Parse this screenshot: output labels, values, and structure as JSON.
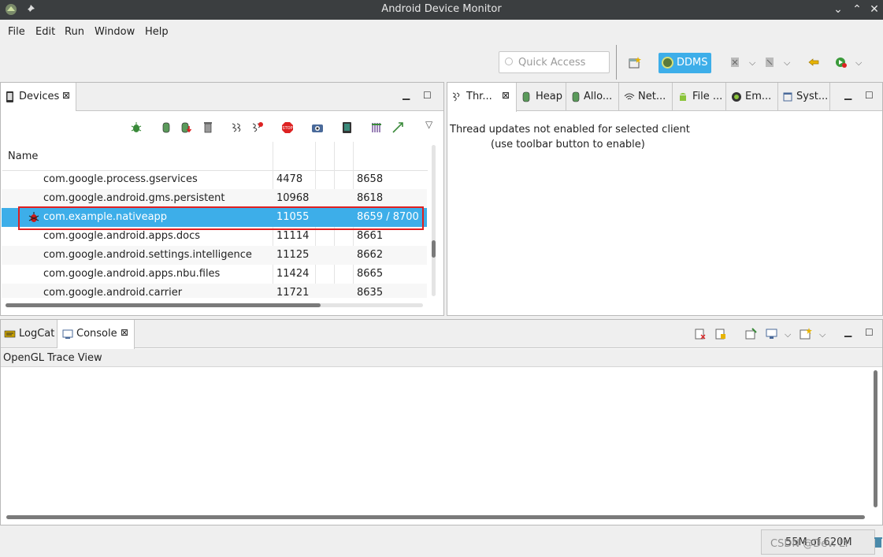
{
  "window": {
    "title": "Android Device Monitor"
  },
  "menu": [
    "File",
    "Edit",
    "Run",
    "Window",
    "Help"
  ],
  "toolbar": {
    "quick_access_placeholder": "Quick Access",
    "perspective_label": "DDMS"
  },
  "devices_panel": {
    "tab_label": "Devices",
    "column_header": "Name",
    "rows": [
      {
        "name": "com.google.process.gservices",
        "pid": "4478",
        "port": "8658"
      },
      {
        "name": "com.google.android.gms.persistent",
        "pid": "10968",
        "port": "8618"
      },
      {
        "name": "com.example.nativeapp",
        "pid": "11055",
        "port": "8659 / 8700"
      },
      {
        "name": "com.google.android.apps.docs",
        "pid": "11114",
        "port": "8661"
      },
      {
        "name": "com.google.android.settings.intelligence",
        "pid": "11125",
        "port": "8662"
      },
      {
        "name": "com.google.android.apps.nbu.files",
        "pid": "11424",
        "port": "8665"
      },
      {
        "name": "com.google.android.carrier",
        "pid": "11721",
        "port": "8635"
      }
    ]
  },
  "right_panel": {
    "tabs": [
      "Thr...",
      "Heap",
      "Allo...",
      "Net...",
      "File ...",
      "Em...",
      "Syst..."
    ],
    "message_line1": "Thread updates not enabled for selected client",
    "message_line2": "(use toolbar button to enable)"
  },
  "bottom_panel": {
    "tabs": [
      "LogCat",
      "Console"
    ],
    "console_title": "OpenGL Trace View"
  },
  "status": {
    "memory": "55M of 620M"
  },
  "watermark": "CSDN @Dev. LY",
  "colors": {
    "selection": "#3daee9",
    "titlebar": "#3b3e40",
    "highlight_box": "#e02020"
  }
}
